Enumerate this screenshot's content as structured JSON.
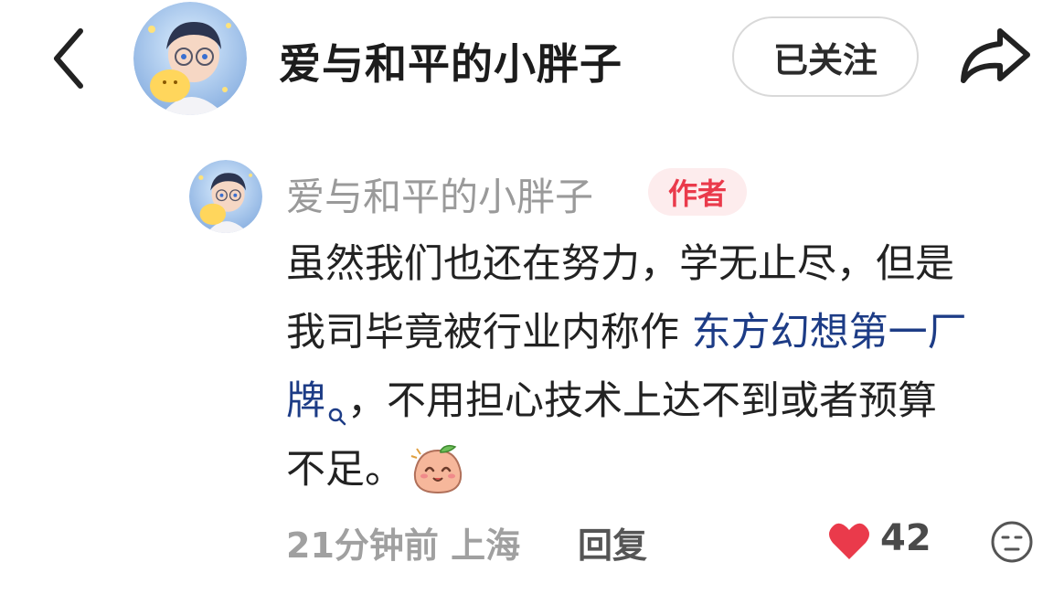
{
  "header": {
    "title": "爱与和平的小胖子",
    "follow_label": "已关注"
  },
  "comment": {
    "author": "爱与和平的小胖子",
    "badge": "作者",
    "line1": "虽然我们也还在努力，学无止尽，但是",
    "line2_prefix": "我司毕竟被行业内称作 ",
    "link_part1": "东方幻想第一厂",
    "link_part2": "牌",
    "line3_suffix": "，不用担心技术上达不到或者预算",
    "line4": "不足。",
    "meta": "21分钟前 上海",
    "reply_label": "回复",
    "like_count": "42"
  },
  "colors": {
    "accent_red": "#ea3a4b",
    "link_blue": "#1d3c86",
    "muted_gray": "#9a9a9a"
  },
  "icons": {
    "back": "chevron-left-icon",
    "share": "share-arrow-icon",
    "search": "search-mini-icon",
    "emoji": "smiling-peach-emoji-icon",
    "like": "heart-icon",
    "reaction": "neutral-face-icon"
  }
}
